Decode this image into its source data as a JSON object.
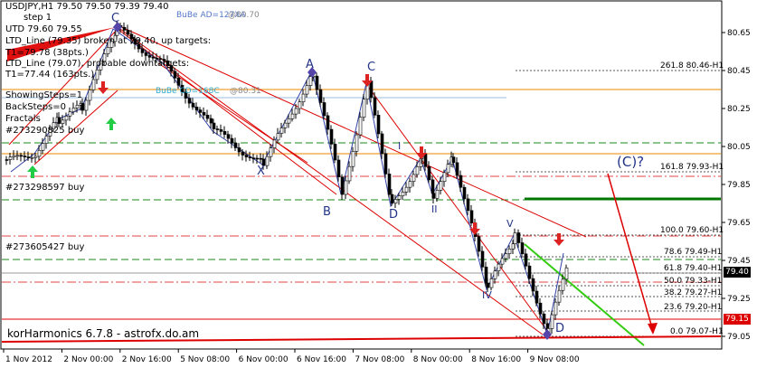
{
  "window": {
    "symbol_line": "USDJPY,H1  79.50 79.50 79.39 79.40"
  },
  "info_panel": {
    "lines": [
      "step 1",
      "UTD 79.60  79.55",
      "LTD_Line (79.35) broken at 79.40, up targets:",
      "T1=79.78 (38pts.)",
      "LTD_Line (79.07), probable downtargets:",
      "T1=77.44 (163pts.)",
      "ShowingSteps=1",
      "BackSteps=0",
      "Fractals"
    ],
    "level_lines": [
      "#273290825 buy",
      "#273298597 buy",
      "#273605427 buy"
    ]
  },
  "indicator_footer": "korHarmonics 6.7.8 - astrofx.do.am",
  "annotations": {
    "bube_ad": "BuBe AD=127XA",
    "bube_ad_price": "@80.70",
    "bube_cd": "BuBe CD=168C",
    "bube_cd_price": "@80.31",
    "wave_label": "(C)?",
    "points": {
      "C_top": "C",
      "A": "A",
      "C": "C",
      "B": "B",
      "D_mid": "D",
      "X": "X",
      "D_end": "D",
      "I": "I",
      "II": "II",
      "V": "V",
      "IV": "IV"
    }
  },
  "fibo_levels": [
    "261.8 80.46-H1",
    "161.8 79.93-H1",
    "100.0 79.60-H1",
    "78.6 79.49-H1",
    "61.8 79.40-H1",
    "50.0 79.33-H1",
    "38.2 79.27-H1",
    "23.6 79.20-H1",
    "0.0 79.07-H1"
  ],
  "price_axis": {
    "ticks": [
      "80.65",
      "80.45",
      "80.25",
      "80.05",
      "79.85",
      "79.65",
      "79.45",
      "79.25",
      "79.05"
    ],
    "current_price": "79.40",
    "red_price": "79.15"
  },
  "time_axis": {
    "ticks": [
      "1 Nov 2012",
      "2 Nov 00:00",
      "2 Nov 16:00",
      "5 Nov 08:00",
      "6 Nov 00:00",
      "6 Nov 16:00",
      "7 Nov 08:00",
      "8 Nov 00:00",
      "8 Nov 16:00",
      "9 Nov 08:00"
    ]
  },
  "colors": {
    "bull": "#000080",
    "bear": "#000000",
    "wick": "#000000",
    "trend": "#dd0000",
    "green_line": "#22cc00",
    "orange": "#f0a030",
    "pattern": "#5555aa"
  }
}
